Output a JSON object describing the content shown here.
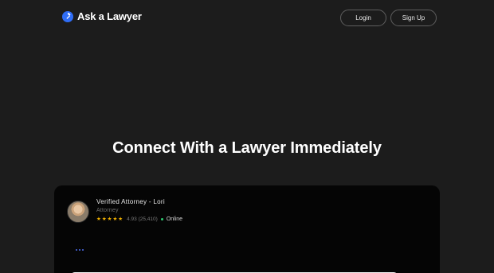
{
  "brand": {
    "name": "Ask a Lawyer",
    "accent": "#2f6df6"
  },
  "nav": {
    "login_label": "Login",
    "signup_label": "Sign Up"
  },
  "hero": {
    "title": "Connect With a Lawyer Immediately"
  },
  "attorney": {
    "name": "Verified Attorney - Lori",
    "role": "Attorney",
    "stars": "★★★★★",
    "star_count": 5,
    "rating": "4.93 (25,410)",
    "status": "Online",
    "status_color": "#2ecc71"
  },
  "icons": {
    "logo": "gavel-icon",
    "avatar": "attorney-avatar"
  }
}
